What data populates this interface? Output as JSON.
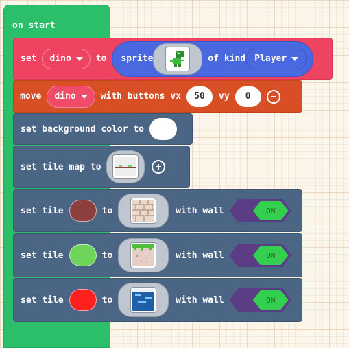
{
  "on_start": {
    "label": "on start"
  },
  "set_sprite": {
    "set_label": "set",
    "variable": "dino",
    "to_label": "to",
    "sprite_label": "sprite",
    "of_kind_label": "of kind",
    "kind": "Player"
  },
  "move": {
    "move_label": "move",
    "variable": "dino",
    "with_buttons_label": "with buttons vx",
    "vx": "50",
    "vy_label": "vy",
    "vy": "0"
  },
  "background": {
    "label": "set background color to",
    "color": "#ffffff"
  },
  "tile_map": {
    "label": "set tile map to"
  },
  "tiles": [
    {
      "set_label": "set tile",
      "to_label": "to",
      "wall_label": "with wall",
      "toggle": "ON",
      "color": "#8b3f3f"
    },
    {
      "set_label": "set tile",
      "to_label": "to",
      "wall_label": "with wall",
      "toggle": "ON",
      "color": "#6fd45a"
    },
    {
      "set_label": "set tile",
      "to_label": "to",
      "wall_label": "with wall",
      "toggle": "ON",
      "color": "#ff2020"
    }
  ]
}
